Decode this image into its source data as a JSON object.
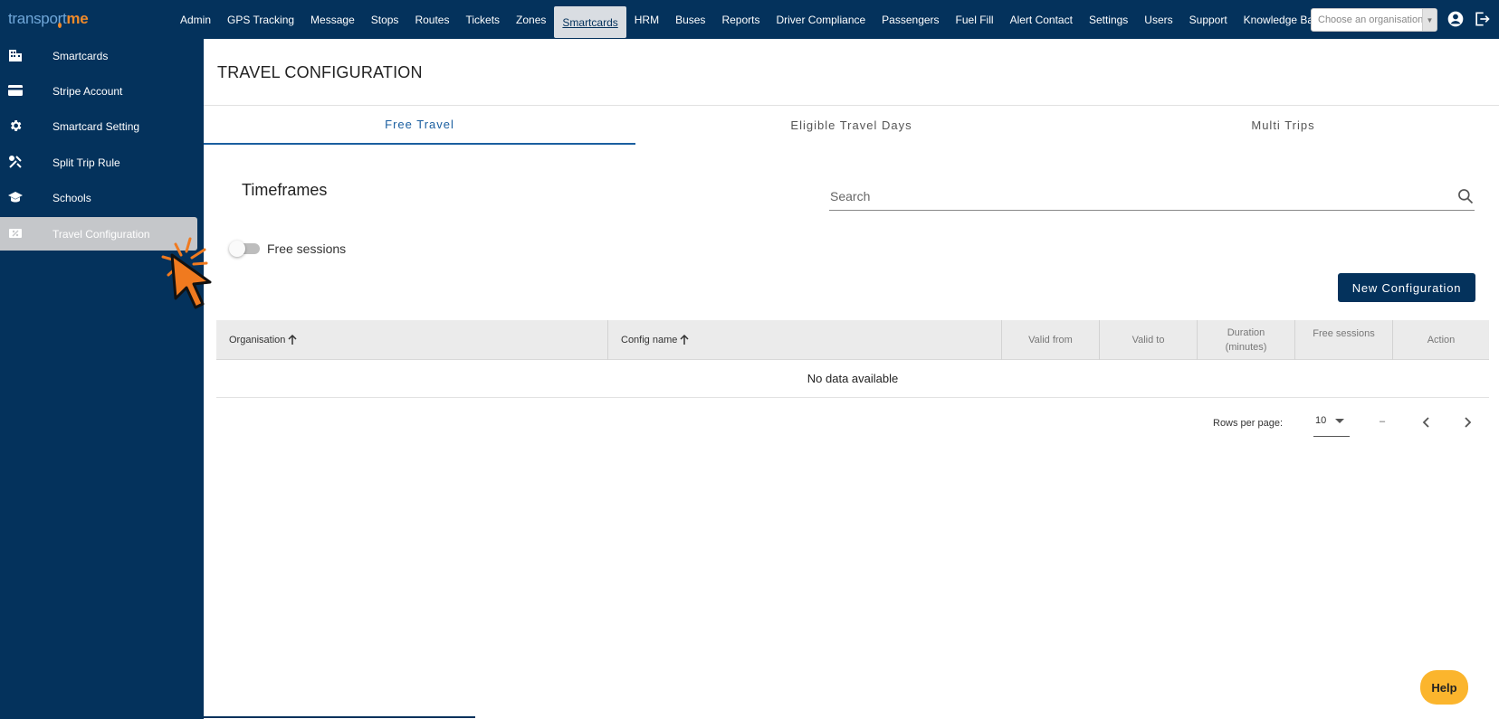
{
  "app": {
    "logo_prefix": "transp",
    "logo_mid": "rt",
    "logo_suffix": "me",
    "org_placeholder": "Choose an organisation"
  },
  "nav": {
    "items": [
      "Admin",
      "GPS Tracking",
      "Message",
      "Stops",
      "Routes",
      "Tickets",
      "Zones",
      "Smartcards",
      "HRM",
      "Buses",
      "Reports",
      "Driver Compliance",
      "Passengers",
      "Fuel Fill",
      "Alert Contact",
      "Settings",
      "Users",
      "Support",
      "Knowledge Base"
    ],
    "active": "Smartcards"
  },
  "sidebar": {
    "items": [
      {
        "label": "Smartcards",
        "icon": "building-icon"
      },
      {
        "label": "Stripe Account",
        "icon": "credit-card-icon"
      },
      {
        "label": "Smartcard Setting",
        "icon": "gear-icon"
      },
      {
        "label": "Split Trip Rule",
        "icon": "tools-icon"
      },
      {
        "label": "Schools",
        "icon": "graduation-cap-icon"
      },
      {
        "label": "Travel Configuration",
        "icon": "ticket-percent-icon"
      }
    ],
    "active": "Travel Configuration"
  },
  "main": {
    "title": "TRAVEL CONFIGURATION",
    "tabs": [
      "Free Travel",
      "Eligible Travel Days",
      "Multi Trips"
    ],
    "active_tab": "Free Travel",
    "section_title": "Timeframes",
    "search_placeholder": "Search",
    "toggle_label": "Free sessions",
    "toggle_on": false,
    "new_button": "New Configuration"
  },
  "table": {
    "columns": {
      "organisation": "Organisation",
      "config_name": "Config name",
      "valid_from": "Valid from",
      "valid_to": "Valid to",
      "duration_line1": "Duration",
      "duration_line2": "(minutes)",
      "free_sessions": "Free sessions",
      "action": "Action"
    },
    "empty_text": "No data available",
    "rows_per_page_label": "Rows per page:",
    "rows_per_page_value": "10",
    "range_text": "–"
  },
  "help": {
    "label": "Help"
  },
  "colors": {
    "navy": "#04325c",
    "accent_blue": "#1b5fa0",
    "help_yellow": "#fbb52d",
    "logo_orange": "#f08a2a"
  }
}
